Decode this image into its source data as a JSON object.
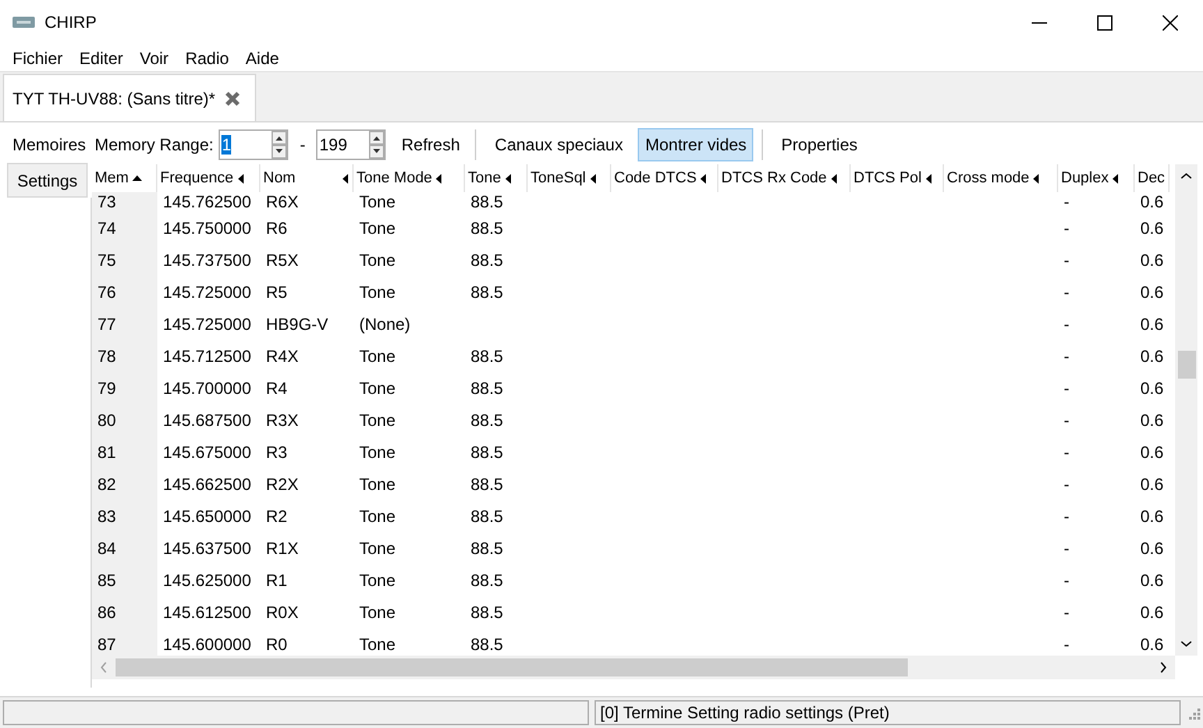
{
  "window": {
    "title": "CHIRP"
  },
  "menu": [
    "Fichier",
    "Editer",
    "Voir",
    "Radio",
    "Aide"
  ],
  "tabs": [
    {
      "label": "TYT TH-UV88: (Sans titre)*",
      "selected": true
    }
  ],
  "side_tabs": [
    {
      "label": "Memoires",
      "selected": true
    },
    {
      "label": "Settings",
      "selected": false
    }
  ],
  "toolbar": {
    "range_label": "Memory Range:",
    "range_start": "1",
    "separator": "-",
    "range_end": "199",
    "buttons": [
      {
        "label": "Refresh",
        "pressed": false,
        "divider_after": true
      },
      {
        "label": "Canaux speciaux",
        "pressed": false,
        "divider_after": false
      },
      {
        "label": "Montrer vides",
        "pressed": true,
        "divider_after": true
      },
      {
        "label": "Properties",
        "pressed": false,
        "divider_after": false
      }
    ]
  },
  "table": {
    "columns": [
      {
        "label": "Mem",
        "sorted": true
      },
      {
        "label": "Frequence",
        "sorted": false
      },
      {
        "label": "Nom",
        "sorted": false
      },
      {
        "label": "Tone Mode",
        "sorted": false
      },
      {
        "label": "Tone",
        "sorted": false
      },
      {
        "label": "ToneSql",
        "sorted": false
      },
      {
        "label": "Code DTCS",
        "sorted": false
      },
      {
        "label": "DTCS Rx Code",
        "sorted": false
      },
      {
        "label": "DTCS Pol",
        "sorted": false
      },
      {
        "label": "Cross mode",
        "sorted": false
      },
      {
        "label": "Duplex",
        "sorted": false
      },
      {
        "label": "Dec"
      }
    ],
    "rows": [
      [
        "73",
        "145.762500",
        "R6X",
        "Tone",
        "88.5",
        "",
        "",
        "",
        "",
        "",
        "-",
        "0.6"
      ],
      [
        "74",
        "145.750000",
        "R6",
        "Tone",
        "88.5",
        "",
        "",
        "",
        "",
        "",
        "-",
        "0.6"
      ],
      [
        "75",
        "145.737500",
        "R5X",
        "Tone",
        "88.5",
        "",
        "",
        "",
        "",
        "",
        "-",
        "0.6"
      ],
      [
        "76",
        "145.725000",
        "R5",
        "Tone",
        "88.5",
        "",
        "",
        "",
        "",
        "",
        "-",
        "0.6"
      ],
      [
        "77",
        "145.725000",
        "HB9G-V",
        "(None)",
        "",
        "",
        "",
        "",
        "",
        "",
        "-",
        "0.6"
      ],
      [
        "78",
        "145.712500",
        "R4X",
        "Tone",
        "88.5",
        "",
        "",
        "",
        "",
        "",
        "-",
        "0.6"
      ],
      [
        "79",
        "145.700000",
        "R4",
        "Tone",
        "88.5",
        "",
        "",
        "",
        "",
        "",
        "-",
        "0.6"
      ],
      [
        "80",
        "145.687500",
        "R3X",
        "Tone",
        "88.5",
        "",
        "",
        "",
        "",
        "",
        "-",
        "0.6"
      ],
      [
        "81",
        "145.675000",
        "R3",
        "Tone",
        "88.5",
        "",
        "",
        "",
        "",
        "",
        "-",
        "0.6"
      ],
      [
        "82",
        "145.662500",
        "R2X",
        "Tone",
        "88.5",
        "",
        "",
        "",
        "",
        "",
        "-",
        "0.6"
      ],
      [
        "83",
        "145.650000",
        "R2",
        "Tone",
        "88.5",
        "",
        "",
        "",
        "",
        "",
        "-",
        "0.6"
      ],
      [
        "84",
        "145.637500",
        "R1X",
        "Tone",
        "88.5",
        "",
        "",
        "",
        "",
        "",
        "-",
        "0.6"
      ],
      [
        "85",
        "145.625000",
        "R1",
        "Tone",
        "88.5",
        "",
        "",
        "",
        "",
        "",
        "-",
        "0.6"
      ],
      [
        "86",
        "145.612500",
        "R0X",
        "Tone",
        "88.5",
        "",
        "",
        "",
        "",
        "",
        "-",
        "0.6"
      ],
      [
        "87",
        "145.600000",
        "R0",
        "Tone",
        "88.5",
        "",
        "",
        "",
        "",
        "",
        "-",
        "0.6"
      ]
    ]
  },
  "status_bar": {
    "message": "[0] Termine Setting radio settings (Pret)"
  }
}
